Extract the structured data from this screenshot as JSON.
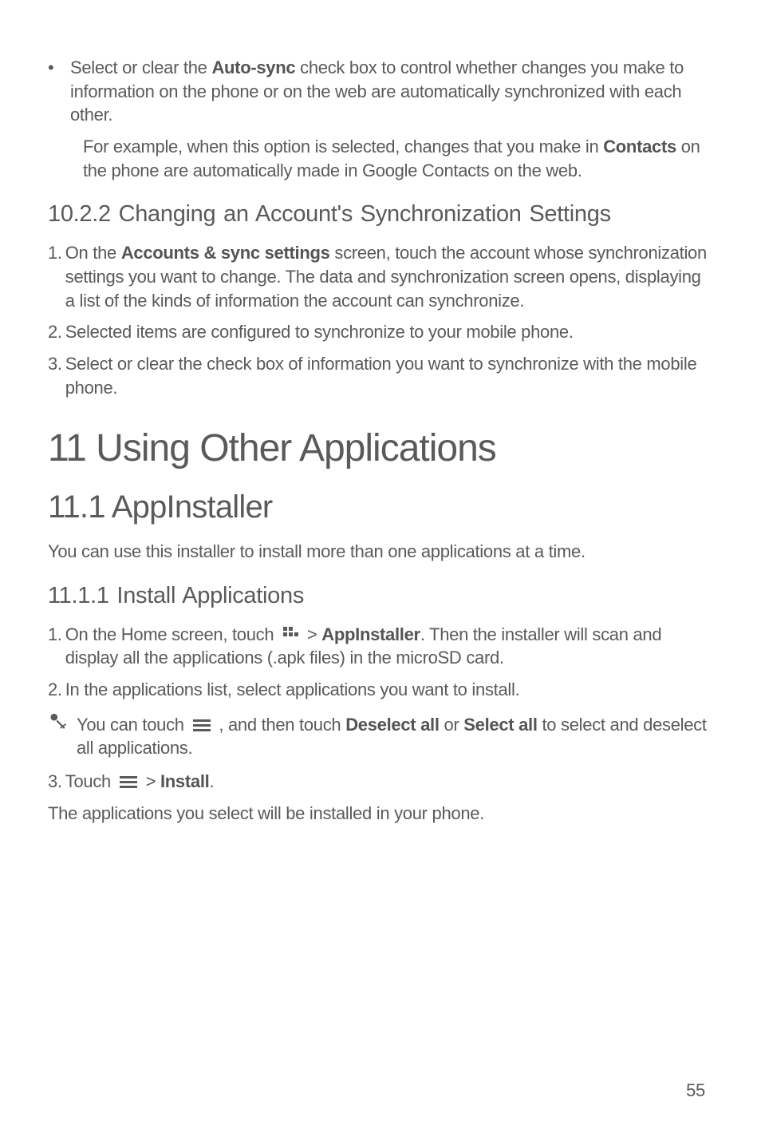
{
  "bullet1": {
    "marker": "•",
    "text_before": "Select or clear the ",
    "bold1": "Auto-sync",
    "text_after": " check box to control whether changes you make to information on the phone or on the web are automatically synchronized with each other."
  },
  "sub_para": {
    "text_before": "For example, when this option is selected, changes that you make in ",
    "bold1": "Contacts",
    "text_after": " on the phone are automatically made in Google Contacts on the web."
  },
  "h3_1": "10.2.2  Changing an Account's Synchronization Settings",
  "list1": {
    "item1": {
      "num": "1. ",
      "text_before": "On the ",
      "bold1": "Accounts & sync settings",
      "text_after": " screen, touch the account whose synchronization settings you want to change. The data and synchronization screen opens, displaying a list of the kinds of information the account can synchronize."
    },
    "item2": {
      "num": "2. ",
      "text": "Selected items are configured to synchronize to your mobile phone."
    },
    "item3": {
      "num": "3. ",
      "text": "Select or clear the check box of information you want to synchronize with the mobile phone."
    }
  },
  "h1": "11  Using Other Applications",
  "h2": "11.1  AppInstaller",
  "body1": "You can use this installer to install more than one applications at a time.",
  "h3_2": "11.1.1  Install Applications",
  "list2": {
    "item1": {
      "num": "1. ",
      "text_before": "On the Home screen, touch ",
      "text_mid": " > ",
      "bold1": "AppInstaller",
      "text_after": ". Then the installer will scan and display all the applications (.apk files) in the microSD card."
    },
    "item2": {
      "num": "2. ",
      "text": "In the applications list, select applications you want to install."
    }
  },
  "note": {
    "text_before": "You can touch ",
    "text_mid": " , and then touch ",
    "bold1": "Deselect all",
    "text_or": " or ",
    "bold2": "Select all",
    "text_after": " to select and deselect all applications."
  },
  "list3": {
    "item1": {
      "num": "3. ",
      "text_before": "Touch ",
      "text_mid": " > ",
      "bold1": "Install",
      "text_after": "."
    }
  },
  "body2": "The applications you select will be installed in your phone.",
  "page_num": "55",
  "icons": {
    "apps": "apps-grid-icon",
    "menu": "menu-icon",
    "note": "note-tip-icon"
  }
}
